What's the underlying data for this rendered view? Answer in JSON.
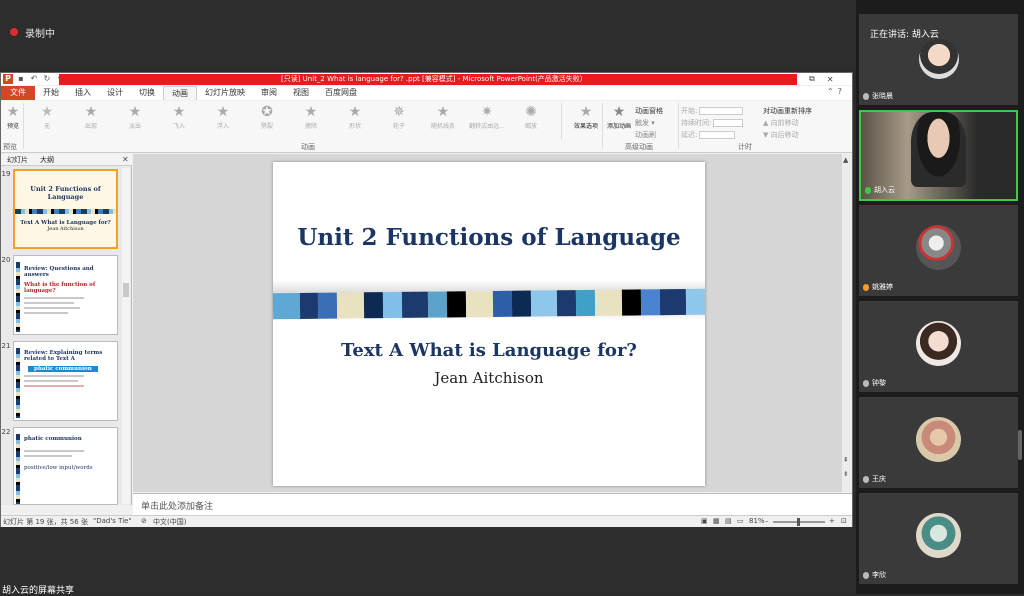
{
  "meeting": {
    "recording_label": "录制中",
    "speaking_label": "正在讲话: 胡入云",
    "share_label": "胡入云的屏幕共享"
  },
  "window": {
    "title": "[只读] Unit_2 What is language for? .ppt [兼容模式] - Microsoft PowerPoint(产品激活失败)",
    "controls": [
      "–",
      "⧉",
      "✕"
    ]
  },
  "ribbon": {
    "tabs": [
      "文件",
      "开始",
      "插入",
      "设计",
      "切换",
      "动画",
      "幻灯片放映",
      "审阅",
      "视图",
      "百度网盘"
    ],
    "active_tab": "动画",
    "preview_label": "预览",
    "animations": [
      "无",
      "出现",
      "淡出",
      "飞入",
      "浮入",
      "劈裂",
      "擦除",
      "形状",
      "轮子",
      "随机线条",
      "翻转式由远...",
      "缩放"
    ],
    "effect_options_label": "效果选项",
    "add_animation_label": "添加动画",
    "advanced": [
      "动画窗格",
      "触发 ▾",
      "动画刷"
    ],
    "timing": [
      "开始:",
      "持续时间:",
      "延迟:"
    ],
    "reorder_title": "对动画重新排序",
    "reorder": [
      "▲ 向前移动",
      "▼ 向后移动"
    ],
    "groups": [
      "预览",
      "动画",
      "高级动画",
      "计时"
    ]
  },
  "panel": {
    "tabs": [
      "幻灯片",
      "大纲"
    ],
    "thumbnails": [
      {
        "num": "19",
        "title": "Unit 2 Functions of Language",
        "sub": "Text A What is Language for?",
        "author": "Jean Aitchison"
      },
      {
        "num": "20",
        "title": "Review: Questions and answers",
        "sub": "What is the function of language?"
      },
      {
        "num": "21",
        "title": "Review: Explaining terms related to Text A",
        "sub": "phatic communion"
      },
      {
        "num": "22",
        "title": "phatic communion",
        "sub": "positive/low input/words"
      }
    ]
  },
  "slide": {
    "title": "Unit 2 Functions of Language",
    "subtitle": "Text A What is Language for?",
    "author": "Jean Aitchison"
  },
  "notes": {
    "placeholder": "单击此处添加备注"
  },
  "status": {
    "slide_info": "幻灯片 第 19 张，共 56 张",
    "theme": "\"Dad's Tie\"",
    "language": "中文(中国)",
    "zoom": "81%"
  },
  "participants": [
    {
      "name": "张晓晨"
    },
    {
      "name": "胡入云"
    },
    {
      "name": "姚雅婷"
    },
    {
      "name": "钟黎"
    },
    {
      "name": "王庆"
    },
    {
      "name": "李欣"
    }
  ],
  "colors": {
    "accent_red": "#e81c1c",
    "file_tab": "#d24726",
    "slide_navy": "#1b3664",
    "active_speaker": "#3fc94a"
  }
}
